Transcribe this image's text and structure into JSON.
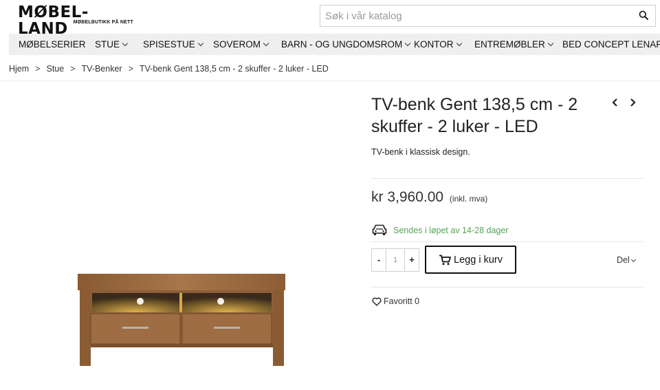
{
  "brand": {
    "name": "MØBEL-LAND",
    "tagline": "MØBELBUTIKK PÅ NETT"
  },
  "search": {
    "placeholder": "Søk i vår katalog",
    "value": ""
  },
  "nav": {
    "items": [
      {
        "label": "MØBELSERIER",
        "has_dropdown": false
      },
      {
        "label": "STUE",
        "has_dropdown": true
      },
      {
        "label": "SPISESTUE",
        "has_dropdown": true
      },
      {
        "label": "SOVEROM",
        "has_dropdown": true
      },
      {
        "label": "BARN - OG UNGDOMSROM",
        "has_dropdown": true
      },
      {
        "label": "KONTOR",
        "has_dropdown": true
      },
      {
        "label": "ENTREMØBLER",
        "has_dropdown": true
      },
      {
        "label": "BED CONCEPT LENART",
        "has_dropdown": false
      }
    ]
  },
  "breadcrumb": {
    "items": [
      "Hjem",
      "Stue",
      "TV-Benker",
      "TV-benk Gent 138,5 cm - 2 skuffer - 2 luker - LED"
    ],
    "separator": ">"
  },
  "product": {
    "title": "TV-benk Gent 138,5 cm - 2 skuffer - 2 luker - LED",
    "description": "TV-benk i klassisk design.",
    "price": "kr 3,960.00",
    "price_note": "(inkl. mva)",
    "shipping": "Sendes i løpet av 14-28 dager",
    "quantity": "1",
    "minus_label": "-",
    "plus_label": "+",
    "add_to_cart": "Legg i kurv",
    "share": "Del",
    "favorite": "Favoritt 0"
  },
  "colors": {
    "shipping_green": "#55a454",
    "nav_bg": "#efefef",
    "wood": "#9a6a3f"
  },
  "icons": {
    "search": "search-icon",
    "prev": "chevron-left-icon",
    "next": "chevron-right-icon",
    "shipping": "car-icon",
    "cart": "cart-icon",
    "favorite": "heart-icon"
  }
}
